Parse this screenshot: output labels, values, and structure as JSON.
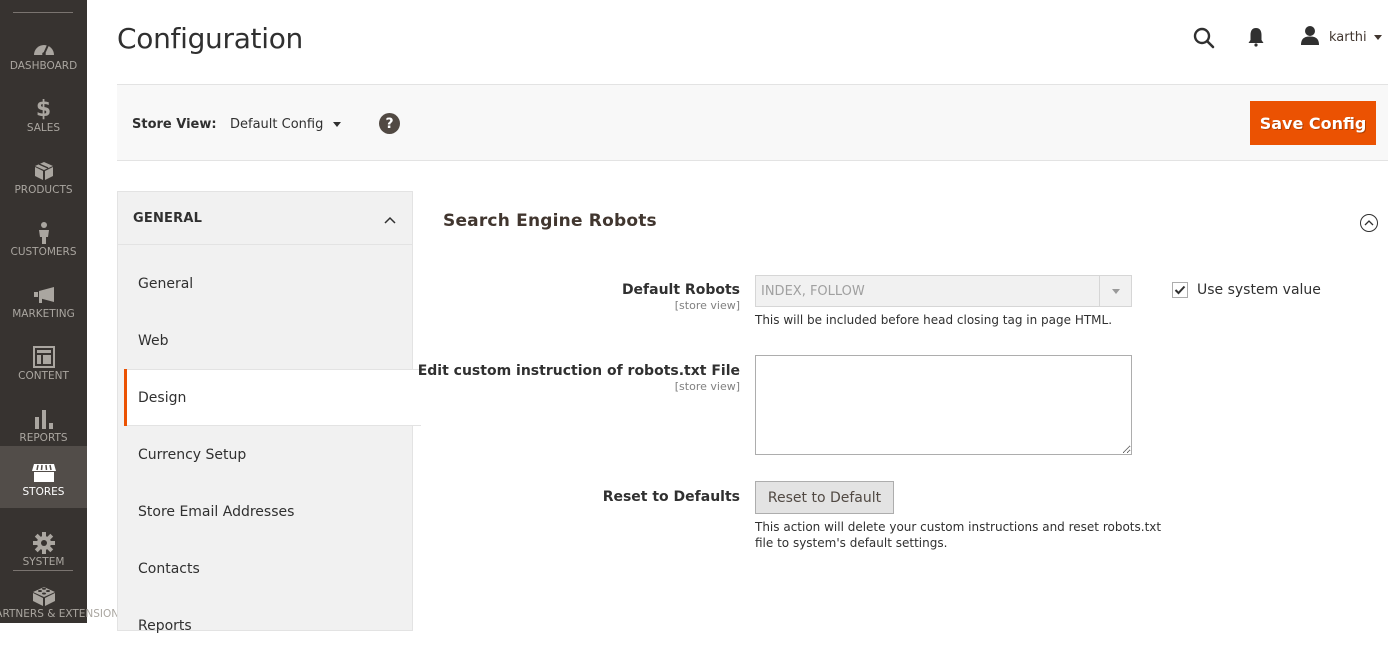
{
  "nav": {
    "items": [
      {
        "label": "Dashboard",
        "icon": "dashboard-icon"
      },
      {
        "label": "Sales",
        "icon": "dollar-icon"
      },
      {
        "label": "Products",
        "icon": "box-icon"
      },
      {
        "label": "Customers",
        "icon": "person-icon"
      },
      {
        "label": "Marketing",
        "icon": "megaphone-icon"
      },
      {
        "label": "Content",
        "icon": "layout-icon"
      },
      {
        "label": "Reports",
        "icon": "bar-chart-icon"
      },
      {
        "label": "Stores",
        "icon": "store-icon",
        "active": true
      },
      {
        "label": "System",
        "icon": "gear-icon"
      },
      {
        "label": "Find Partners & Extensions",
        "icon": "lego-brick-icon"
      }
    ]
  },
  "header": {
    "title": "Configuration",
    "user_name": "karthi"
  },
  "store_bar": {
    "label": "Store View:",
    "selected": "Default Config",
    "help": "?",
    "save_label": "Save Config"
  },
  "tabs": {
    "group_title": "GENERAL",
    "items": [
      {
        "label": "General"
      },
      {
        "label": "Web"
      },
      {
        "label": "Design",
        "active": true
      },
      {
        "label": "Currency Setup"
      },
      {
        "label": "Store Email Addresses"
      },
      {
        "label": "Contacts"
      },
      {
        "label": "Reports"
      }
    ]
  },
  "section": {
    "title": "Search Engine Robots",
    "fields": {
      "default_robots": {
        "label": "Default Robots",
        "scope": "[store view]",
        "value": "INDEX, FOLLOW",
        "note": "This will be included before head closing tag in page HTML.",
        "use_system_label": "Use system value",
        "use_system_checked": true
      },
      "custom_instructions": {
        "label": "Edit custom instruction of robots.txt File",
        "scope": "[store view]",
        "value": ""
      },
      "reset": {
        "label": "Reset to Defaults",
        "button": "Reset to Default",
        "note_line1": "This action will delete your custom instructions and reset robots.txt",
        "note_line2": "file to system's default settings."
      }
    }
  },
  "colors": {
    "accent": "#eb5202",
    "nav_bg": "#373330",
    "nav_active_bg": "#524d49"
  }
}
